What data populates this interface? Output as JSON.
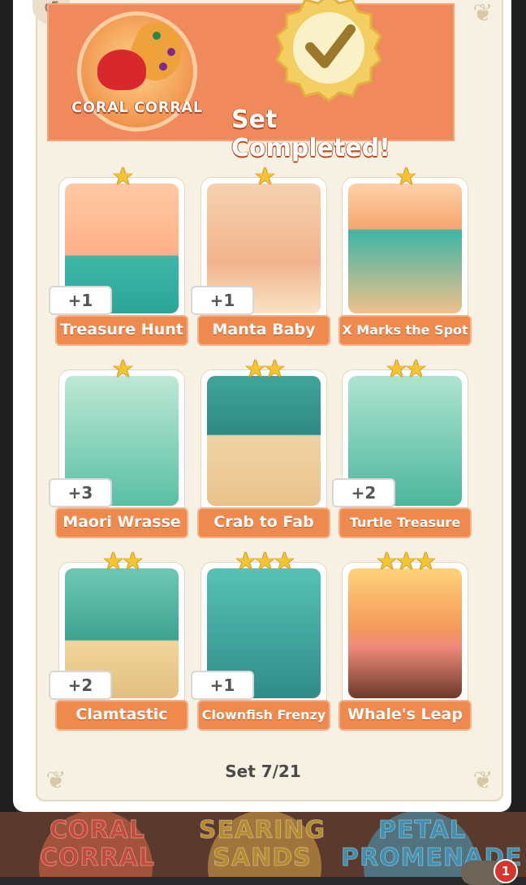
{
  "header": {
    "set_name": "CORAL CORRAL",
    "status": "Set Completed!"
  },
  "cards": [
    {
      "title": "Treasure Hunt",
      "stars": 1,
      "duplicates": "+1"
    },
    {
      "title": "Manta Baby",
      "stars": 1,
      "duplicates": "+1"
    },
    {
      "title": "X Marks the Spot",
      "stars": 1,
      "duplicates": ""
    },
    {
      "title": "Maori Wrasse",
      "stars": 1,
      "duplicates": "+3"
    },
    {
      "title": "Crab to Fab",
      "stars": 2,
      "duplicates": ""
    },
    {
      "title": "Turtle Treasure",
      "stars": 2,
      "duplicates": "+2"
    },
    {
      "title": "Clamtastic",
      "stars": 2,
      "duplicates": "+2"
    },
    {
      "title": "Clownfish Frenzy",
      "stars": 3,
      "duplicates": "+1"
    },
    {
      "title": "Whale's Leap",
      "stars": 3,
      "duplicates": ""
    }
  ],
  "footer": {
    "progress": "Set 7/21"
  },
  "background_sets": [
    {
      "name_line1": "CORAL",
      "name_line2": "CORRAL"
    },
    {
      "name_line1": "SEARING",
      "name_line2": "SANDS"
    },
    {
      "name_line1": "PETAL",
      "name_line2": "PROMENADE"
    }
  ],
  "notification_count": "1",
  "colors": {
    "header": "#f08a5d",
    "label": "#ef8a4f",
    "panel": "#f7f1e3",
    "star": "#f5c431"
  }
}
